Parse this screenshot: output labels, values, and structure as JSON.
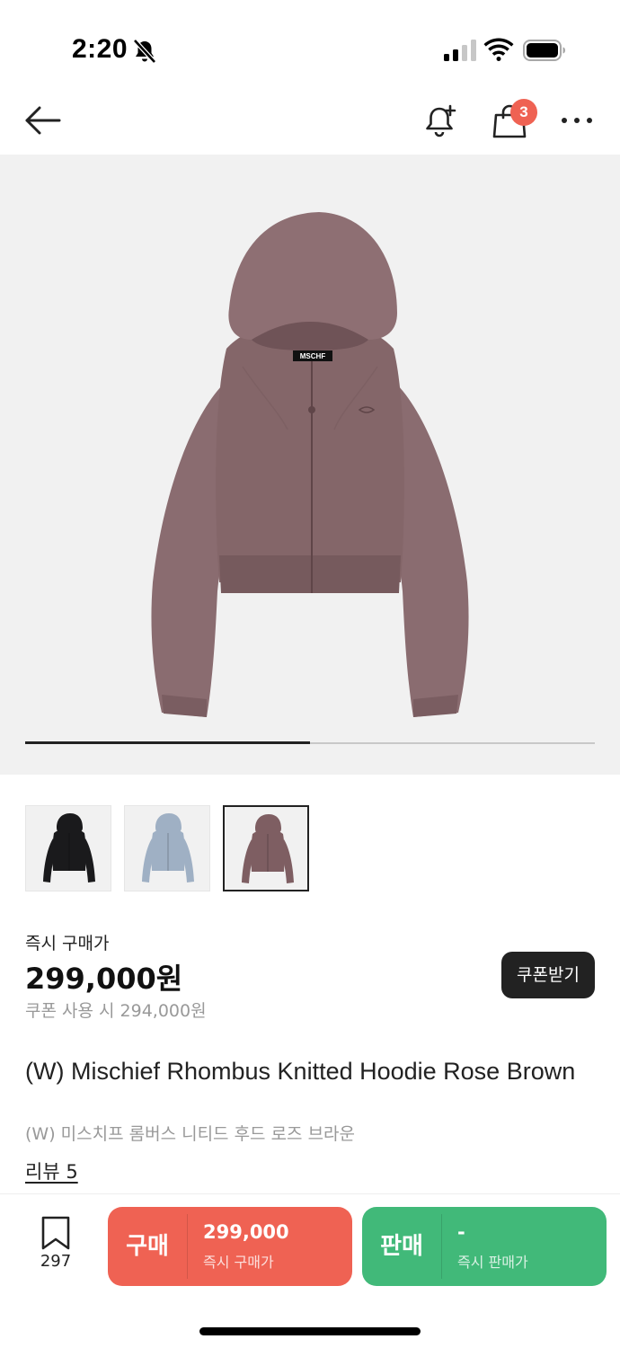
{
  "status_bar": {
    "time": "2:20",
    "icons": [
      "bell-slash-icon",
      "cellular-signal-icon",
      "wifi-icon",
      "battery-icon"
    ]
  },
  "nav": {
    "icons": [
      "back-arrow-icon",
      "bell-plus-icon",
      "shopping-bag-icon",
      "more-horizontal-icon"
    ],
    "cart_badge": "3"
  },
  "gallery": {
    "progress": 0.5,
    "thumbnails": [
      {
        "color": "#1a1a1c",
        "label": "black"
      },
      {
        "color": "#9fb0c4",
        "label": "light blue"
      },
      {
        "color": "#7e5e62",
        "label": "rose brown",
        "active": true
      }
    ],
    "hero_tag": "MSCHF"
  },
  "price": {
    "label": "즉시 구매가",
    "value": "299,000원",
    "coupon_text": "쿠폰 사용 시 294,000원",
    "coupon_button": "쿠폰받기"
  },
  "product": {
    "name": "(W) Mischief Rhombus Knitted Hoodie Rose Brown",
    "name_korean": "(W) 미스치프 롬버스 니티드 후드 로즈 브라운",
    "review_link": "리뷰 5"
  },
  "bottom_bar": {
    "bookmark_count": "297",
    "buy": {
      "label": "구매",
      "price": "299,000",
      "sub": "즉시 구매가",
      "color": "#ef6253"
    },
    "sell": {
      "label": "판매",
      "price": "-",
      "sub": "즉시 판매가",
      "color": "#41b979"
    }
  }
}
